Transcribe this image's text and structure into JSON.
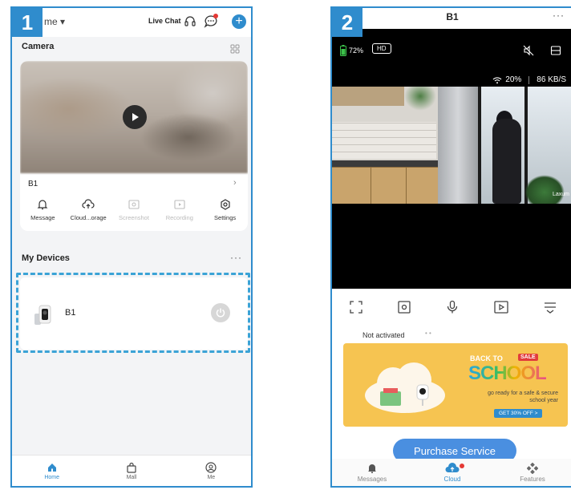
{
  "steps": [
    "1",
    "2"
  ],
  "screen1": {
    "header": {
      "home_label": "me ▾",
      "live_chat_label": "Live Chat",
      "add_symbol": "+"
    },
    "camera_section_title": "Camera",
    "camera_card": {
      "camera_name": "B1",
      "chevron": "›",
      "actions": [
        {
          "label": "Message",
          "icon": "bell-icon",
          "enabled": true
        },
        {
          "label": "Cloud...orage",
          "icon": "cloud-upload-icon",
          "enabled": true
        },
        {
          "label": "Screenshot",
          "icon": "screenshot-icon",
          "enabled": false
        },
        {
          "label": "Recording",
          "icon": "video-record-icon",
          "enabled": false
        },
        {
          "label": "Settings",
          "icon": "gear-icon",
          "enabled": true
        }
      ]
    },
    "devices_section_title": "My Devices",
    "more_symbol": "···",
    "device": {
      "name": "B1"
    },
    "nav": [
      {
        "label": "Home",
        "icon": "home-icon",
        "active": true
      },
      {
        "label": "Mall",
        "icon": "shopping-bag-icon",
        "active": false
      },
      {
        "label": "Me",
        "icon": "profile-icon",
        "active": false
      }
    ],
    "accent_color": "#2f8ccd",
    "highlight_color": "#3ba3d6"
  },
  "screen2": {
    "title": "B1",
    "more_symbol": "···",
    "battery_label": "72%",
    "hd_label": "HD",
    "wifi_label": "20%",
    "speed_label": "86 KB/S",
    "watermark": "Laxum",
    "controls": [
      "fullscreen-icon",
      "screenshot-icon",
      "microphone-icon",
      "record-icon",
      "menu-icon"
    ],
    "not_activated_label": "Not activated",
    "na_dots": "• •",
    "promo": {
      "back_to": "BACK TO",
      "sale": "SALE",
      "school": "SCHOOL",
      "line1": "go ready for a safe & secure",
      "line2": "school year",
      "cta": "GET 30% OFF >"
    },
    "purchase_label": "Purchase Service",
    "nav": [
      {
        "label": "Messages",
        "icon": "bell-icon",
        "active": false
      },
      {
        "label": "Cloud",
        "icon": "cloud-upload-icon",
        "active": true
      },
      {
        "label": "Features",
        "icon": "features-icon",
        "active": false
      }
    ]
  }
}
